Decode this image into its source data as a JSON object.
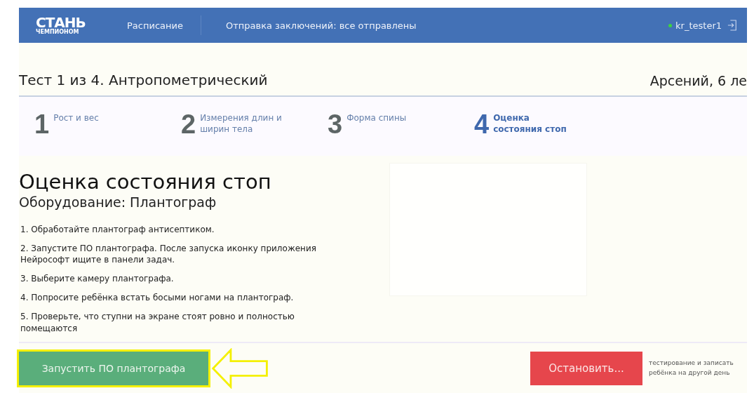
{
  "header": {
    "logo": {
      "title": "СТАНЬ",
      "subtitle": "ЧЕМПИОНОМ"
    },
    "nav": [
      "Расписание",
      "Отправка заключений: все отправлены"
    ],
    "user": {
      "name": "kr_tester1",
      "online": true
    }
  },
  "test_title": "Тест 1 из 4. Антропометрический",
  "child": "Арсений, 6 ле",
  "steps": [
    {
      "number": "1",
      "label": "Рост и вес",
      "selected": false
    },
    {
      "number": "2",
      "label": "Измерения длин и ширин тела",
      "selected": false
    },
    {
      "number": "3",
      "label": "Форма спины",
      "selected": false
    },
    {
      "number": "4",
      "label": "Оценка состояния стоп",
      "selected": true
    }
  ],
  "section": {
    "title": "Оценка состояния стоп",
    "equipment": "Оборудование: Плантограф",
    "instructions": [
      "1. Обработайте плантограф антисептиком.",
      "2. Запустите ПО плантографа. После запуска иконку приложения Нейрософт ищите в панели задач.",
      "3. Выберите камеру плантографа.",
      "4. Попросите ребёнка встать босыми ногами на плантограф.",
      "5. Проверьте, что ступни на экране стоят ровно и полностью помещаются"
    ]
  },
  "footer": {
    "primary_button": "Запустить ПО плантографа",
    "stop_button": "Остановить...",
    "stop_note": "тестирование и записать ребёнка на другой день",
    "highlighted": true
  }
}
